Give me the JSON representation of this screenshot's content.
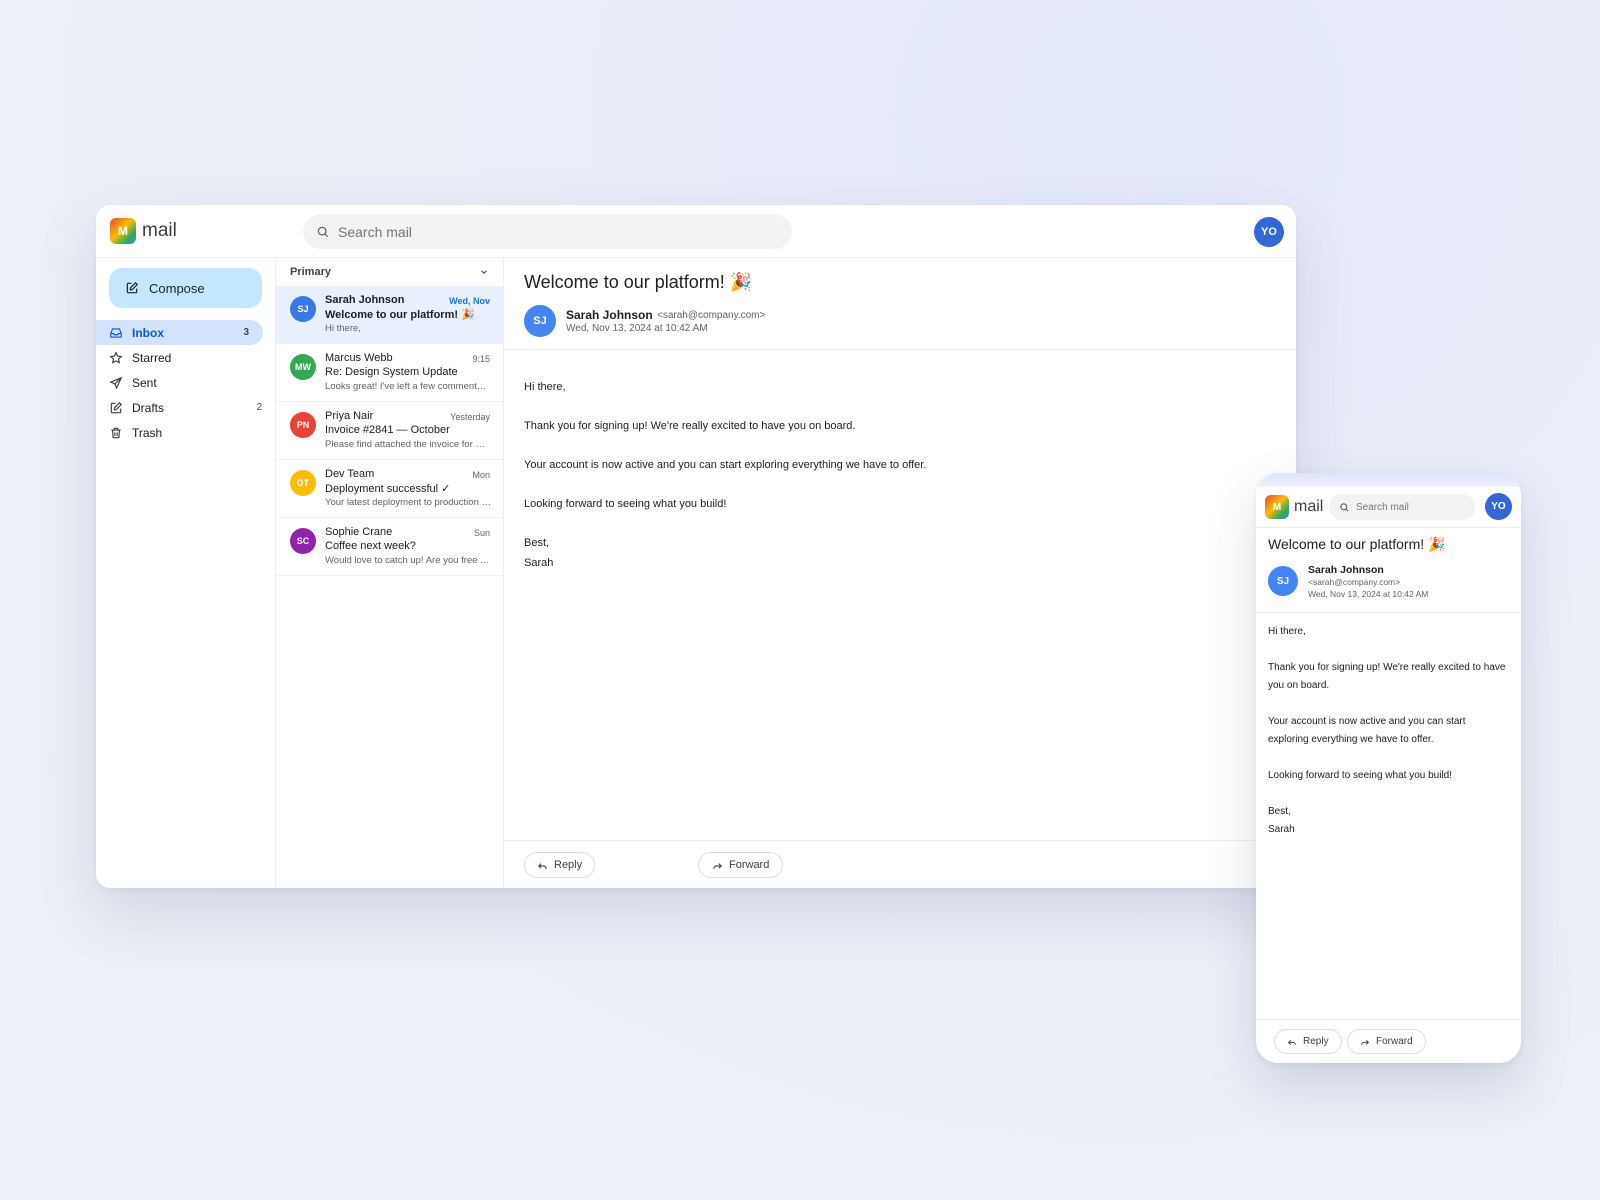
{
  "app": {
    "logo_letter": "M",
    "name": "mail",
    "user_initials": "YO"
  },
  "search": {
    "placeholder": "Search mail"
  },
  "sidebar": {
    "compose_label": "Compose",
    "items": [
      {
        "label": "Inbox",
        "count": "3",
        "icon": "inbox-icon"
      },
      {
        "label": "Starred",
        "count": "",
        "icon": "star-icon"
      },
      {
        "label": "Sent",
        "count": "",
        "icon": "send-icon"
      },
      {
        "label": "Drafts",
        "count": "2",
        "icon": "edit-icon"
      },
      {
        "label": "Trash",
        "count": "",
        "icon": "trash-icon"
      }
    ]
  },
  "list": {
    "category": "Primary",
    "messages": [
      {
        "initials": "SJ",
        "color": "#3b78e7",
        "from": "Sarah Johnson",
        "time": "Wed, Nov",
        "subject": "Welcome to our platform! 🎉",
        "preview": "Hi there,"
      },
      {
        "initials": "MW",
        "color": "#34a853",
        "from": "Marcus Webb",
        "time": "9:15",
        "subject": "Re: Design System Update",
        "preview": "Looks great! I've left a few comments on the component library."
      },
      {
        "initials": "PN",
        "color": "#ea4335",
        "from": "Priya Nair",
        "time": "Yesterday",
        "subject": "Invoice #2841 — October",
        "preview": "Please find attached the invoice for October services."
      },
      {
        "initials": "DT",
        "color": "#fbbc04",
        "from": "Dev Team",
        "time": "Mon",
        "subject": "Deployment successful ✓",
        "preview": "Your latest deployment to production completed successfully."
      },
      {
        "initials": "SC",
        "color": "#8e24aa",
        "from": "Sophie Crane",
        "time": "Sun",
        "subject": "Coffee next week?",
        "preview": "Would love to catch up! Are you free Tuesday or Wednesday?"
      }
    ]
  },
  "email": {
    "subject": "Welcome to our platform! 🎉",
    "sender_initials": "SJ",
    "sender_name": "Sarah Johnson",
    "sender_email": "<sarah@company.com>",
    "date": "Wed, Nov 13, 2024 at 10:42 AM",
    "greeting": "Hi there,",
    "para1": "Thank you for signing up! We're really excited to have you on board.",
    "para2": "Your account is now active and you can start exploring everything we have to offer.",
    "para3": "Looking forward to seeing what you build!",
    "signoff": "Best,",
    "signature": "Sarah"
  },
  "actions": {
    "reply": "Reply",
    "forward": "Forward"
  }
}
